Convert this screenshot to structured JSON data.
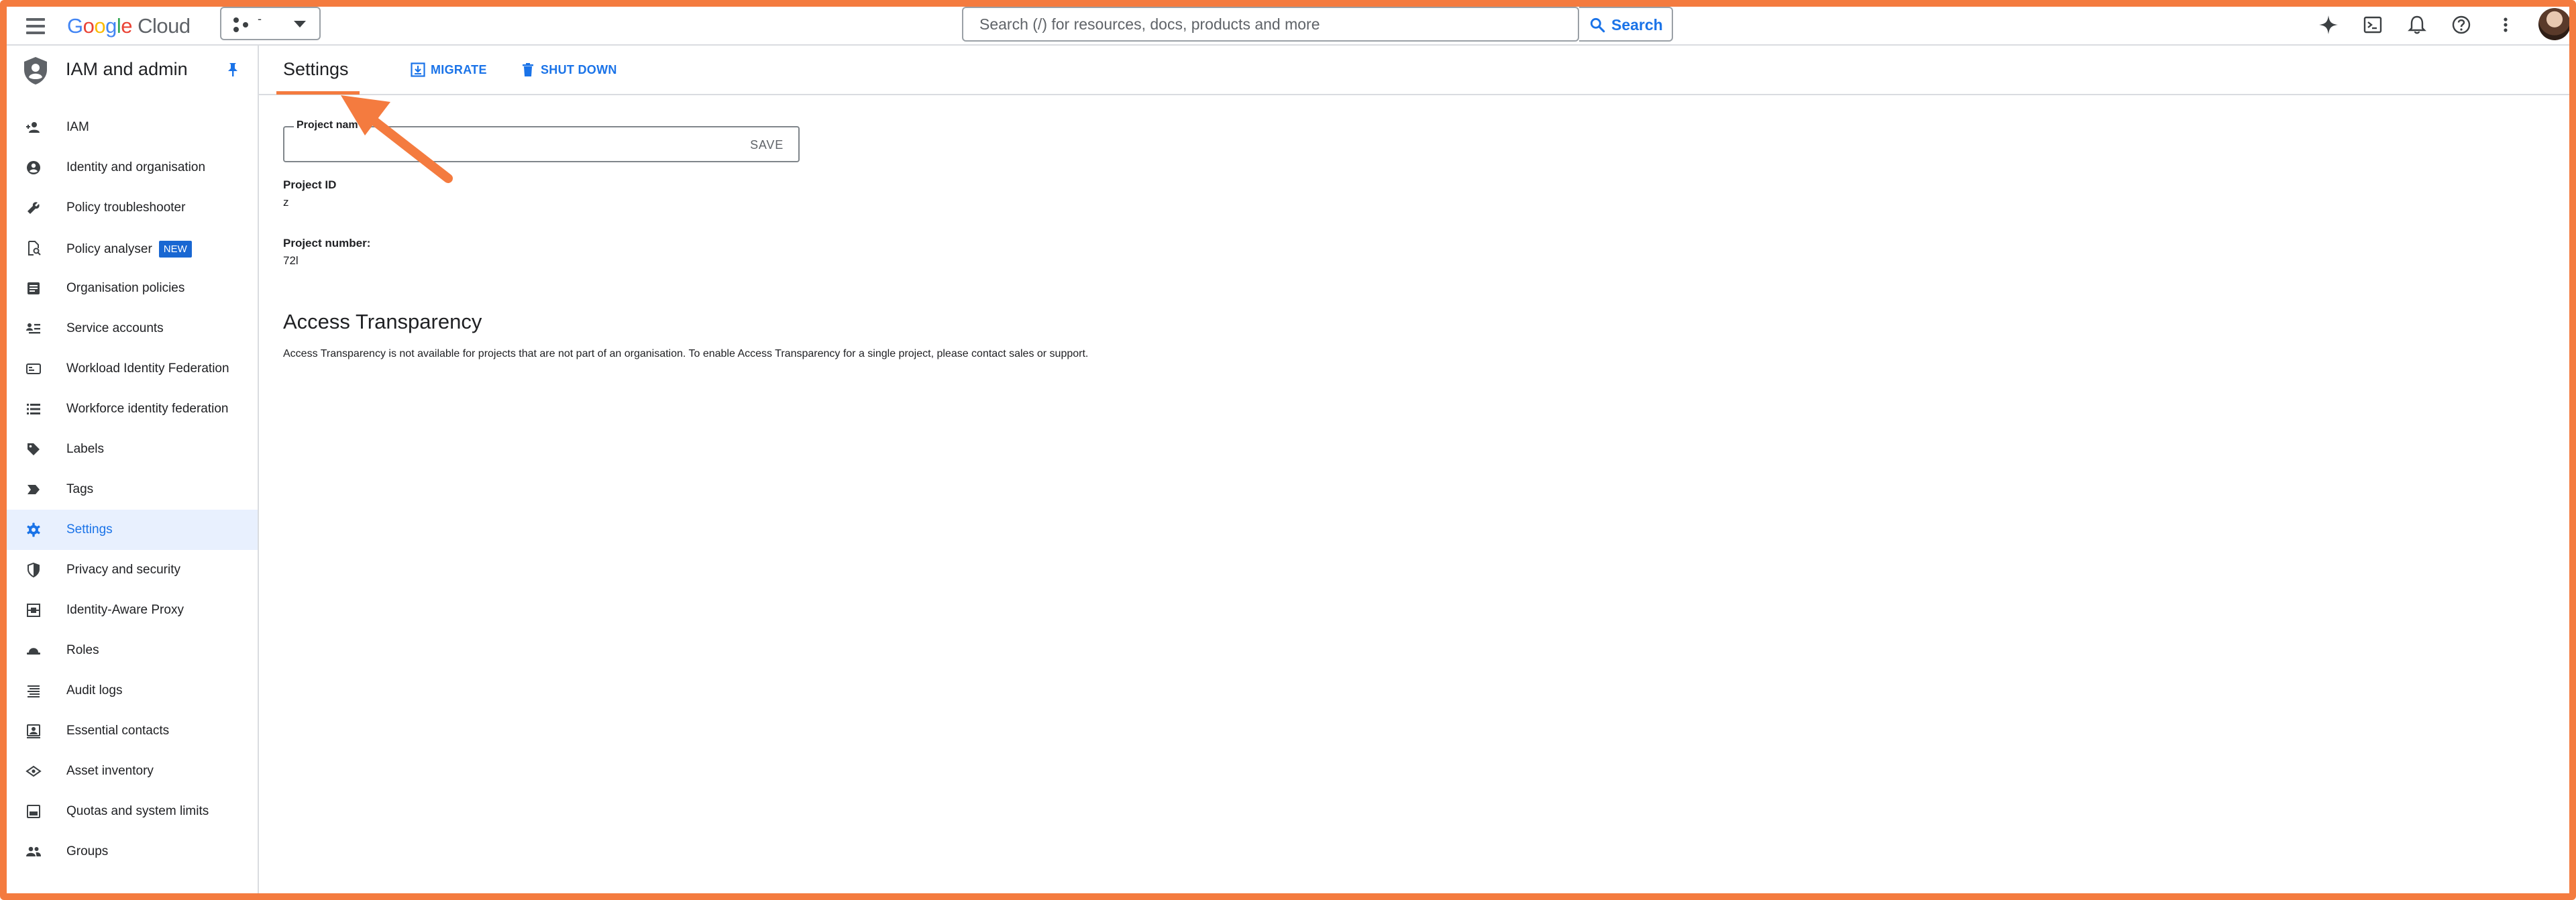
{
  "colors": {
    "accent": "#1a73e8",
    "annotation": "#f47b3f",
    "active_bg": "#e8f0fe",
    "badge": "#1967d2"
  },
  "topbar": {
    "logo_letters": [
      "G",
      "o",
      "o",
      "g",
      "l",
      "e"
    ],
    "logo_product": "Cloud",
    "project_name": "-",
    "search_placeholder": "Search (/) for resources, docs, products and more",
    "search_button": "Search",
    "icons": [
      "gemini-spark-icon",
      "cloud-shell-icon",
      "notifications-bell-icon",
      "help-icon",
      "more-vert-icon"
    ]
  },
  "sidebar": {
    "title": "IAM and admin",
    "items": [
      {
        "label": "IAM",
        "icon": "person-add-icon"
      },
      {
        "label": "Identity and organisation",
        "icon": "account-circle-icon"
      },
      {
        "label": "Policy troubleshooter",
        "icon": "wrench-icon"
      },
      {
        "label": "Policy analyser",
        "icon": "policy-search-icon",
        "badge": "NEW"
      },
      {
        "label": "Organisation policies",
        "icon": "article-icon"
      },
      {
        "label": "Service accounts",
        "icon": "service-account-icon"
      },
      {
        "label": "Workload Identity Federation",
        "icon": "id-card-icon"
      },
      {
        "label": "Workforce identity federation",
        "icon": "list-icon"
      },
      {
        "label": "Labels",
        "icon": "label-tag-icon"
      },
      {
        "label": "Tags",
        "icon": "tag-chevron-icon"
      },
      {
        "label": "Settings",
        "icon": "gear-icon",
        "active": true
      },
      {
        "label": "Privacy and security",
        "icon": "shield-icon"
      },
      {
        "label": "Identity-Aware Proxy",
        "icon": "proxy-icon"
      },
      {
        "label": "Roles",
        "icon": "roles-hat-icon"
      },
      {
        "label": "Audit logs",
        "icon": "lines-icon"
      },
      {
        "label": "Essential contacts",
        "icon": "contact-icon"
      },
      {
        "label": "Asset inventory",
        "icon": "eye-diamond-icon"
      },
      {
        "label": "Quotas and system limits",
        "icon": "quota-icon"
      },
      {
        "label": "Groups",
        "icon": "group-icon"
      }
    ]
  },
  "main": {
    "title": "Settings",
    "migrate": "MIGRATE",
    "shutdown": "SHUT DOWN",
    "project_name_label": "Project nam",
    "save": "SAVE",
    "project_id_label": "Project ID",
    "project_id_value": "z",
    "project_number_label": "Project number:",
    "project_number_value": "72l",
    "access_title": "Access Transparency",
    "access_text": "Access Transparency is not available for projects that are not part of an organisation. To enable Access Transparency for a single project, please contact sales or support."
  }
}
